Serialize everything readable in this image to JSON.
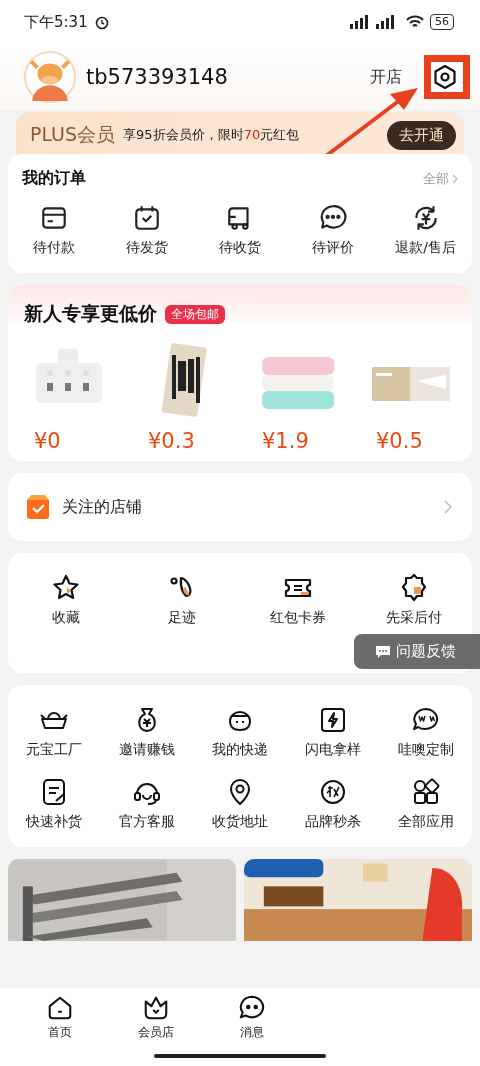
{
  "status_bar": {
    "time": "下午5:31",
    "battery": "56"
  },
  "profile": {
    "username": "tb573393148",
    "open_shop": "开店"
  },
  "plus": {
    "title": "PLUS会员",
    "text": "享95折会员价，限时**70**元红包",
    "button": "去开通"
  },
  "orders": {
    "title": "我的订单",
    "all": "全部",
    "items": [
      {
        "label": "待付款"
      },
      {
        "label": "待发货"
      },
      {
        "label": "待收货"
      },
      {
        "label": "待评价"
      },
      {
        "label": "退款/售后"
      }
    ]
  },
  "newcomer": {
    "title": "新人专享更低价",
    "tag": "全场包邮",
    "products": [
      {
        "kind": "socket",
        "price": "¥0"
      },
      {
        "kind": "tools",
        "price": "¥0.3"
      },
      {
        "kind": "towels",
        "price": "¥1.9"
      },
      {
        "kind": "card",
        "price": "¥0.5"
      }
    ]
  },
  "followed_shops": {
    "label": "关注的店铺"
  },
  "quick": [
    {
      "label": "收藏"
    },
    {
      "label": "足迹"
    },
    {
      "label": "红包卡券"
    },
    {
      "label": "先采后付"
    }
  ],
  "feedback": {
    "label": "问题反馈"
  },
  "services": [
    {
      "label": "元宝工厂"
    },
    {
      "label": "邀请赚钱"
    },
    {
      "label": "我的快递"
    },
    {
      "label": "闪电拿样"
    },
    {
      "label": "哇噢定制"
    },
    {
      "label": "快速补货"
    },
    {
      "label": "官方客服"
    },
    {
      "label": "收货地址"
    },
    {
      "label": "品牌秒杀"
    },
    {
      "label": "全部应用"
    }
  ],
  "tab_bar": [
    {
      "label": "首页",
      "selected": false
    },
    {
      "label": "会员店",
      "selected": false
    },
    {
      "label": "消息",
      "selected": false
    }
  ]
}
